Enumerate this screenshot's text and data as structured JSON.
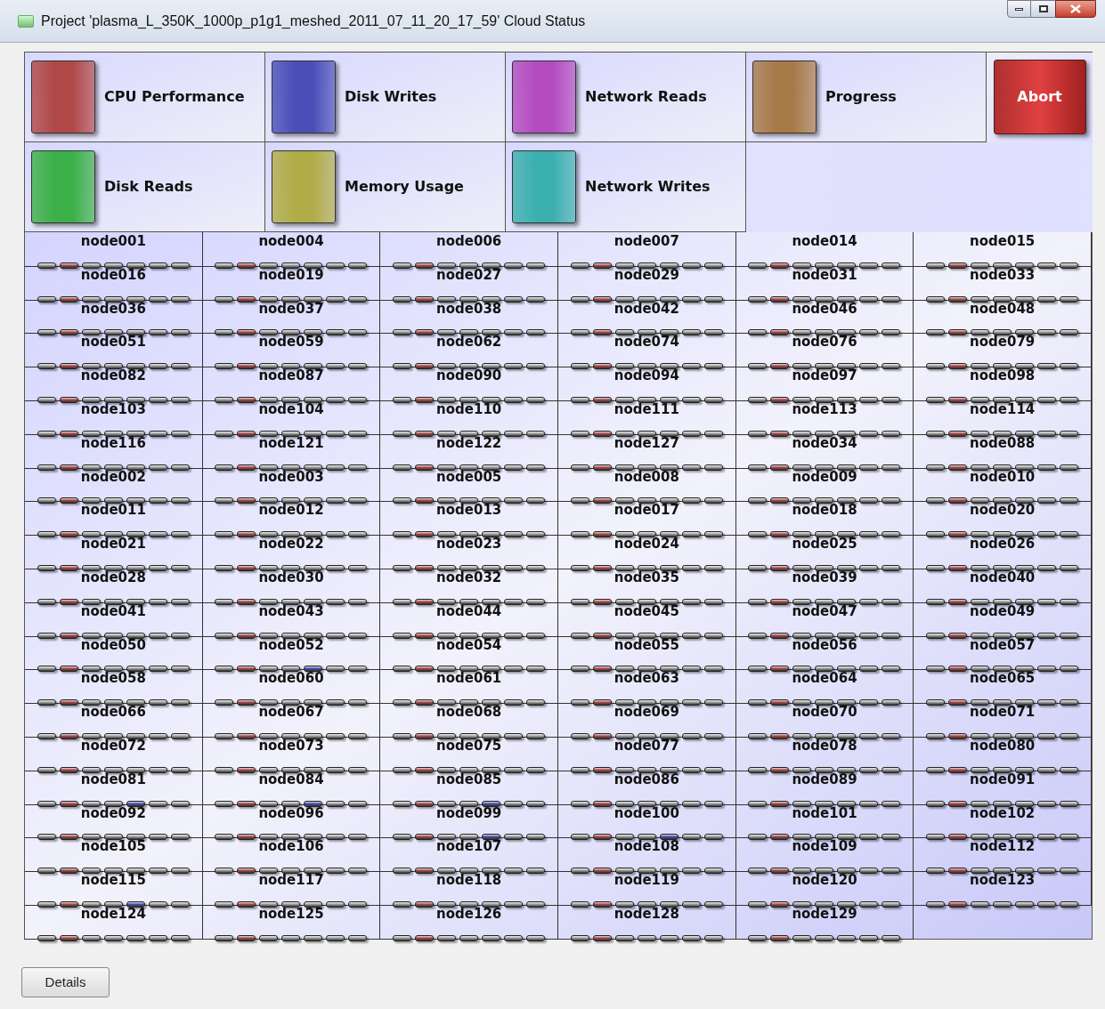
{
  "window": {
    "title": "Project 'plasma_L_350K_1000p_p1g1_meshed_2011_07_11_20_17_59' Cloud Status"
  },
  "legend": [
    {
      "label": "CPU Performance",
      "color": "#b04848"
    },
    {
      "label": "Disk Writes",
      "color": "#4a4fb8"
    },
    {
      "label": "Network Reads",
      "color": "#b44cc0"
    },
    {
      "label": "Progress",
      "color": "#a87a48"
    },
    {
      "label": "Disk Reads",
      "color": "#3cb048"
    },
    {
      "label": "Memory Usage",
      "color": "#b0ac48"
    },
    {
      "label": "Network Writes",
      "color": "#3cb0b0"
    }
  ],
  "abort_button": "Abort",
  "nodes": [
    {
      "name": "node001",
      "cpu": true,
      "writes": false
    },
    {
      "name": "node004",
      "cpu": true,
      "writes": false
    },
    {
      "name": "node006",
      "cpu": true,
      "writes": false
    },
    {
      "name": "node007",
      "cpu": true,
      "writes": false
    },
    {
      "name": "node014",
      "cpu": true,
      "writes": false
    },
    {
      "name": "node015",
      "cpu": true,
      "writes": false
    },
    {
      "name": "node016",
      "cpu": true,
      "writes": false
    },
    {
      "name": "node019",
      "cpu": true,
      "writes": false
    },
    {
      "name": "node027",
      "cpu": true,
      "writes": false
    },
    {
      "name": "node029",
      "cpu": true,
      "writes": false
    },
    {
      "name": "node031",
      "cpu": true,
      "writes": false
    },
    {
      "name": "node033",
      "cpu": true,
      "writes": false
    },
    {
      "name": "node036",
      "cpu": true,
      "writes": false
    },
    {
      "name": "node037",
      "cpu": true,
      "writes": false
    },
    {
      "name": "node038",
      "cpu": true,
      "writes": false
    },
    {
      "name": "node042",
      "cpu": true,
      "writes": false
    },
    {
      "name": "node046",
      "cpu": true,
      "writes": false
    },
    {
      "name": "node048",
      "cpu": true,
      "writes": false
    },
    {
      "name": "node051",
      "cpu": true,
      "writes": false
    },
    {
      "name": "node059",
      "cpu": true,
      "writes": false
    },
    {
      "name": "node062",
      "cpu": true,
      "writes": false
    },
    {
      "name": "node074",
      "cpu": true,
      "writes": false
    },
    {
      "name": "node076",
      "cpu": true,
      "writes": false
    },
    {
      "name": "node079",
      "cpu": true,
      "writes": false
    },
    {
      "name": "node082",
      "cpu": true,
      "writes": false
    },
    {
      "name": "node087",
      "cpu": true,
      "writes": false
    },
    {
      "name": "node090",
      "cpu": true,
      "writes": false
    },
    {
      "name": "node094",
      "cpu": true,
      "writes": false
    },
    {
      "name": "node097",
      "cpu": true,
      "writes": false
    },
    {
      "name": "node098",
      "cpu": true,
      "writes": false
    },
    {
      "name": "node103",
      "cpu": true,
      "writes": false
    },
    {
      "name": "node104",
      "cpu": true,
      "writes": false
    },
    {
      "name": "node110",
      "cpu": true,
      "writes": false
    },
    {
      "name": "node111",
      "cpu": true,
      "writes": false
    },
    {
      "name": "node113",
      "cpu": true,
      "writes": false
    },
    {
      "name": "node114",
      "cpu": true,
      "writes": false
    },
    {
      "name": "node116",
      "cpu": true,
      "writes": false
    },
    {
      "name": "node121",
      "cpu": true,
      "writes": false
    },
    {
      "name": "node122",
      "cpu": true,
      "writes": false
    },
    {
      "name": "node127",
      "cpu": true,
      "writes": false
    },
    {
      "name": "node034",
      "cpu": true,
      "writes": false
    },
    {
      "name": "node088",
      "cpu": true,
      "writes": false
    },
    {
      "name": "node002",
      "cpu": true,
      "writes": false
    },
    {
      "name": "node003",
      "cpu": true,
      "writes": false
    },
    {
      "name": "node005",
      "cpu": true,
      "writes": false
    },
    {
      "name": "node008",
      "cpu": true,
      "writes": false
    },
    {
      "name": "node009",
      "cpu": true,
      "writes": false
    },
    {
      "name": "node010",
      "cpu": true,
      "writes": false
    },
    {
      "name": "node011",
      "cpu": true,
      "writes": false
    },
    {
      "name": "node012",
      "cpu": true,
      "writes": false
    },
    {
      "name": "node013",
      "cpu": true,
      "writes": false
    },
    {
      "name": "node017",
      "cpu": true,
      "writes": false
    },
    {
      "name": "node018",
      "cpu": true,
      "writes": false
    },
    {
      "name": "node020",
      "cpu": true,
      "writes": false
    },
    {
      "name": "node021",
      "cpu": true,
      "writes": false
    },
    {
      "name": "node022",
      "cpu": true,
      "writes": false
    },
    {
      "name": "node023",
      "cpu": true,
      "writes": false
    },
    {
      "name": "node024",
      "cpu": true,
      "writes": false
    },
    {
      "name": "node025",
      "cpu": true,
      "writes": false
    },
    {
      "name": "node026",
      "cpu": true,
      "writes": false
    },
    {
      "name": "node028",
      "cpu": true,
      "writes": false
    },
    {
      "name": "node030",
      "cpu": true,
      "writes": false
    },
    {
      "name": "node032",
      "cpu": true,
      "writes": false
    },
    {
      "name": "node035",
      "cpu": true,
      "writes": false
    },
    {
      "name": "node039",
      "cpu": true,
      "writes": false
    },
    {
      "name": "node040",
      "cpu": true,
      "writes": false
    },
    {
      "name": "node041",
      "cpu": true,
      "writes": false
    },
    {
      "name": "node043",
      "cpu": true,
      "writes": false
    },
    {
      "name": "node044",
      "cpu": true,
      "writes": false
    },
    {
      "name": "node045",
      "cpu": true,
      "writes": false
    },
    {
      "name": "node047",
      "cpu": true,
      "writes": false
    },
    {
      "name": "node049",
      "cpu": true,
      "writes": false
    },
    {
      "name": "node050",
      "cpu": true,
      "writes": false
    },
    {
      "name": "node052",
      "cpu": true,
      "writes": true
    },
    {
      "name": "node054",
      "cpu": true,
      "writes": false
    },
    {
      "name": "node055",
      "cpu": true,
      "writes": false
    },
    {
      "name": "node056",
      "cpu": true,
      "writes": false
    },
    {
      "name": "node057",
      "cpu": true,
      "writes": false
    },
    {
      "name": "node058",
      "cpu": true,
      "writes": false
    },
    {
      "name": "node060",
      "cpu": true,
      "writes": false
    },
    {
      "name": "node061",
      "cpu": true,
      "writes": false
    },
    {
      "name": "node063",
      "cpu": true,
      "writes": false
    },
    {
      "name": "node064",
      "cpu": true,
      "writes": false
    },
    {
      "name": "node065",
      "cpu": true,
      "writes": false
    },
    {
      "name": "node066",
      "cpu": true,
      "writes": false
    },
    {
      "name": "node067",
      "cpu": true,
      "writes": false
    },
    {
      "name": "node068",
      "cpu": true,
      "writes": false
    },
    {
      "name": "node069",
      "cpu": true,
      "writes": false
    },
    {
      "name": "node070",
      "cpu": true,
      "writes": false
    },
    {
      "name": "node071",
      "cpu": true,
      "writes": false
    },
    {
      "name": "node072",
      "cpu": true,
      "writes": false
    },
    {
      "name": "node073",
      "cpu": true,
      "writes": false
    },
    {
      "name": "node075",
      "cpu": true,
      "writes": false
    },
    {
      "name": "node077",
      "cpu": true,
      "writes": false
    },
    {
      "name": "node078",
      "cpu": true,
      "writes": false
    },
    {
      "name": "node080",
      "cpu": true,
      "writes": false
    },
    {
      "name": "node081",
      "cpu": true,
      "writes": true
    },
    {
      "name": "node084",
      "cpu": true,
      "writes": true
    },
    {
      "name": "node085",
      "cpu": true,
      "writes": true
    },
    {
      "name": "node086",
      "cpu": true,
      "writes": false
    },
    {
      "name": "node089",
      "cpu": true,
      "writes": false
    },
    {
      "name": "node091",
      "cpu": true,
      "writes": false
    },
    {
      "name": "node092",
      "cpu": true,
      "writes": false
    },
    {
      "name": "node096",
      "cpu": true,
      "writes": false
    },
    {
      "name": "node099",
      "cpu": true,
      "writes": true
    },
    {
      "name": "node100",
      "cpu": true,
      "writes": true
    },
    {
      "name": "node101",
      "cpu": true,
      "writes": false
    },
    {
      "name": "node102",
      "cpu": true,
      "writes": false
    },
    {
      "name": "node105",
      "cpu": true,
      "writes": false
    },
    {
      "name": "node106",
      "cpu": true,
      "writes": false
    },
    {
      "name": "node107",
      "cpu": true,
      "writes": false
    },
    {
      "name": "node108",
      "cpu": true,
      "writes": false
    },
    {
      "name": "node109",
      "cpu": true,
      "writes": false
    },
    {
      "name": "node112",
      "cpu": true,
      "writes": false
    },
    {
      "name": "node115",
      "cpu": true,
      "writes": true
    },
    {
      "name": "node117",
      "cpu": true,
      "writes": false
    },
    {
      "name": "node118",
      "cpu": true,
      "writes": false
    },
    {
      "name": "node119",
      "cpu": true,
      "writes": false
    },
    {
      "name": "node120",
      "cpu": true,
      "writes": false
    },
    {
      "name": "node123",
      "cpu": true,
      "writes": false
    },
    {
      "name": "node124",
      "cpu": true,
      "writes": false
    },
    {
      "name": "node125",
      "cpu": true,
      "writes": false
    },
    {
      "name": "node126",
      "cpu": true,
      "writes": false
    },
    {
      "name": "node128",
      "cpu": true,
      "writes": false
    },
    {
      "name": "node129",
      "cpu": true,
      "writes": false
    }
  ],
  "details_button": "Details"
}
